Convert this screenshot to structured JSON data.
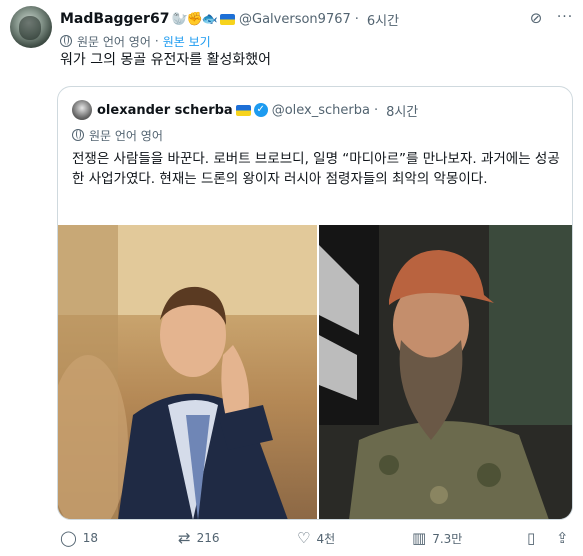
{
  "tweet": {
    "display_name": "MadBagger67",
    "name_emoji": "🦭✊🐟",
    "handle": "@Galverson9767",
    "separator": "·",
    "time": "6시간",
    "lang_note": "원문 언어 영어",
    "translate_link_sep": "·",
    "show_original": "원본 보기",
    "text": "워가 그의 몽골 유전자를 활성화했어"
  },
  "quoted": {
    "display_name": "olexander scherba",
    "verified_glyph": "✓",
    "handle": "@olex_scherba",
    "separator": "·",
    "time": "8시간",
    "lang_note": "원문 언어 영어",
    "text": "전쟁은 사람들을 바꾼다. 로버트 브로브디, 일명 “마디아르”를 만나보자. 과거에는 성공한 사업가였다. 현재는 드론의 왕이자 러시아 점령자들의 최악의 악몽이다."
  },
  "icons": {
    "grok": "grok-icon",
    "more": "more-icon",
    "reply": "reply-icon",
    "retweet": "retweet-icon",
    "like": "like-icon",
    "views": "views-icon",
    "bookmark": "bookmark-icon",
    "share": "share-icon",
    "globe": "globe-icon"
  },
  "actions": {
    "reply_count": "18",
    "retweet_count": "216",
    "like_count": "4천",
    "view_count": "7.3만"
  },
  "colors": {
    "link": "#1d9bf0",
    "muted": "#536471",
    "border": "#cfd9de"
  }
}
